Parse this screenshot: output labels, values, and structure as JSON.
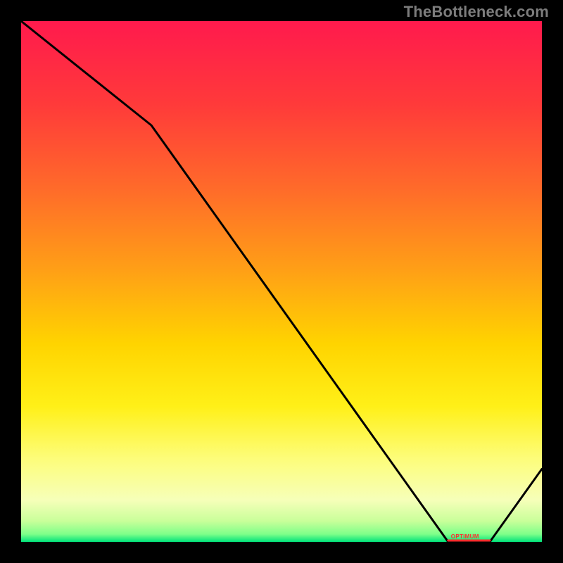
{
  "watermark": "TheBottleneck.com",
  "marker_label": "OPTIMUM",
  "chart_data": {
    "type": "line",
    "title": "",
    "xlabel": "",
    "ylabel": "",
    "xlim": [
      0,
      100
    ],
    "ylim": [
      0,
      100
    ],
    "series": [
      {
        "name": "curve",
        "x": [
          0,
          25,
          82,
          90,
          100
        ],
        "y": [
          100,
          80,
          0,
          0,
          14
        ]
      }
    ],
    "optimal_range_x": [
      82,
      90
    ],
    "gradient_bands": [
      {
        "pos": 0.0,
        "color": "#ff1a4d"
      },
      {
        "pos": 0.16,
        "color": "#ff3a3a"
      },
      {
        "pos": 0.32,
        "color": "#ff6a2a"
      },
      {
        "pos": 0.48,
        "color": "#ffa016"
      },
      {
        "pos": 0.62,
        "color": "#ffd400"
      },
      {
        "pos": 0.74,
        "color": "#fff018"
      },
      {
        "pos": 0.84,
        "color": "#fdfd7a"
      },
      {
        "pos": 0.92,
        "color": "#f6ffb9"
      },
      {
        "pos": 0.96,
        "color": "#c9ff9a"
      },
      {
        "pos": 0.985,
        "color": "#7fff8a"
      },
      {
        "pos": 1.0,
        "color": "#00e27a"
      }
    ]
  }
}
